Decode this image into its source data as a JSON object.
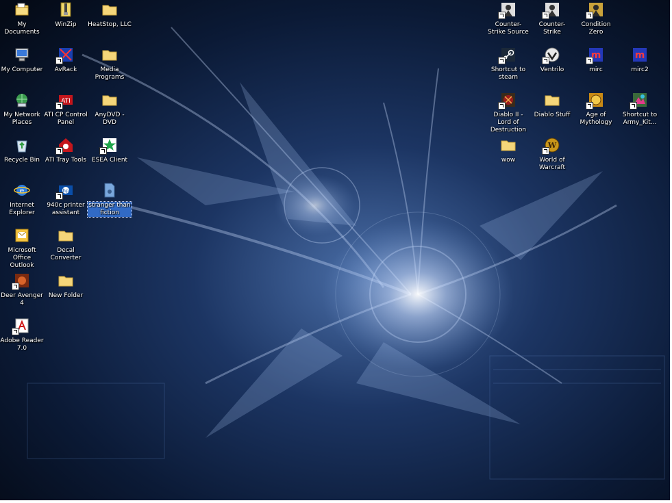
{
  "desktop_left": [
    {
      "id": "my-documents",
      "label": "My Documents",
      "icon": "my-documents-icon",
      "shortcut": false
    },
    {
      "id": "winzip",
      "label": "WinZip",
      "icon": "winzip-icon",
      "shortcut": false
    },
    {
      "id": "heatstop",
      "label": "HeatStop, LLC",
      "icon": "folder-icon",
      "shortcut": false
    },
    {
      "id": "my-computer",
      "label": "My Computer",
      "icon": "my-computer-icon",
      "shortcut": false
    },
    {
      "id": "avrack",
      "label": "AvRack",
      "icon": "avrack-icon",
      "shortcut": true
    },
    {
      "id": "media-programs",
      "label": "Media Programs",
      "icon": "folder-icon",
      "shortcut": false
    },
    {
      "id": "my-network-places",
      "label": "My Network Places",
      "icon": "my-network-places-icon",
      "shortcut": false
    },
    {
      "id": "ati-control-panel",
      "label": "ATI CP Control Panel",
      "icon": "ati-icon",
      "shortcut": true
    },
    {
      "id": "anydvd",
      "label": "AnyDVD - DVD",
      "icon": "folder-icon",
      "shortcut": false
    },
    {
      "id": "recycle-bin",
      "label": "Recycle Bin",
      "icon": "recycle-bin-icon",
      "shortcut": false
    },
    {
      "id": "ati-tray-tools",
      "label": "ATI Tray Tools",
      "icon": "ati-tray-tools-icon",
      "shortcut": true
    },
    {
      "id": "esea-client",
      "label": "ESEA Client",
      "icon": "esea-icon",
      "shortcut": true
    },
    {
      "id": "internet-explorer",
      "label": "Internet Explorer",
      "icon": "internet-explorer-icon",
      "shortcut": false
    },
    {
      "id": "hp-printer",
      "label": "940c printer assistant",
      "icon": "hp-icon",
      "shortcut": true
    },
    {
      "id": "stranger-than-fiction",
      "label": "stranger than fiction",
      "icon": "file-icon",
      "shortcut": false,
      "selected": true
    },
    {
      "id": "outlook",
      "label": "Microsoft Office Outlook",
      "icon": "outlook-icon",
      "shortcut": false
    },
    {
      "id": "decal-converter",
      "label": "Decal Converter",
      "icon": "folder-icon",
      "shortcut": false
    },
    {
      "id": "deer-avenger",
      "label": "Deer Avenger 4",
      "icon": "deer-avenger-icon",
      "shortcut": true
    },
    {
      "id": "new-folder",
      "label": "New Folder",
      "icon": "folder-icon",
      "shortcut": false
    },
    {
      "id": "adobe-reader",
      "label": "Adobe Reader 7.0",
      "icon": "adobe-reader-icon",
      "shortcut": true
    }
  ],
  "desktop_right": [
    {
      "id": "cs-source",
      "label": "Counter-Strike Source",
      "icon": "counter-strike-icon",
      "shortcut": true
    },
    {
      "id": "counter-strike",
      "label": "Counter-Strike",
      "icon": "counter-strike-icon",
      "shortcut": true
    },
    {
      "id": "condition-zero",
      "label": "Condition Zero",
      "icon": "condition-zero-icon",
      "shortcut": true
    },
    {
      "id": "steam",
      "label": "Shortcut to steam",
      "icon": "steam-icon",
      "shortcut": true
    },
    {
      "id": "ventrilo",
      "label": "Ventrilo",
      "icon": "ventrilo-icon",
      "shortcut": true
    },
    {
      "id": "mirc",
      "label": "mirc",
      "icon": "mirc-icon",
      "shortcut": true
    },
    {
      "id": "mirc2",
      "label": "mirc2",
      "icon": "mirc-icon",
      "shortcut": false
    },
    {
      "id": "diablo-lod",
      "label": "Diablo II - Lord of Destruction",
      "icon": "diablo-icon",
      "shortcut": true
    },
    {
      "id": "diablo-stuff",
      "label": "Diablo Stuff",
      "icon": "folder-icon",
      "shortcut": false
    },
    {
      "id": "age-of-mythology",
      "label": "Age of Mythology",
      "icon": "age-of-mythology-icon",
      "shortcut": true
    },
    {
      "id": "army-kit",
      "label": "Shortcut to Army_Kit...",
      "icon": "army-kit-icon",
      "shortcut": true
    },
    {
      "id": "wow-folder",
      "label": "wow",
      "icon": "folder-icon",
      "shortcut": false
    },
    {
      "id": "world-of-warcraft",
      "label": "World of Warcraft",
      "icon": "world-of-warcraft-icon",
      "shortcut": true
    }
  ],
  "colors": {
    "wallpaper_dark": "#06101f",
    "wallpaper_mid": "#1a3566",
    "highlight": "#316ac5"
  }
}
